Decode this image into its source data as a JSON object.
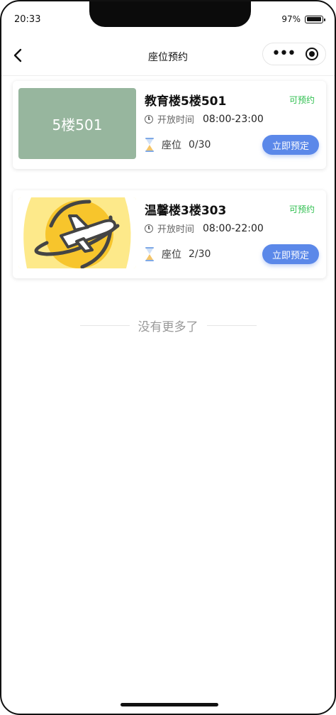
{
  "status_bar": {
    "time": "20:33",
    "battery": "97%",
    "battery_level": 0.97
  },
  "navbar": {
    "title": "座位预约"
  },
  "rooms": [
    {
      "thumb_text": "5楼501",
      "thumb_color": "#97b69e",
      "name": "教育楼5楼501",
      "status": "可预约",
      "open_label": "开放时间",
      "open_time": "08:00-23:00",
      "seat_label": "座位",
      "seats": "0/30",
      "button": "立即预定"
    },
    {
      "thumb_text": "",
      "thumb_icon": "airplane-logo-icon",
      "name": "温馨楼3楼303",
      "status": "可预约",
      "open_label": "开放时间",
      "open_time": "08:00-22:00",
      "seat_label": "座位",
      "seats": "2/30",
      "button": "立即预定"
    }
  ],
  "footer": {
    "no_more": "没有更多了"
  },
  "colors": {
    "accent": "#5b88e9",
    "available": "#2fbf4f"
  }
}
